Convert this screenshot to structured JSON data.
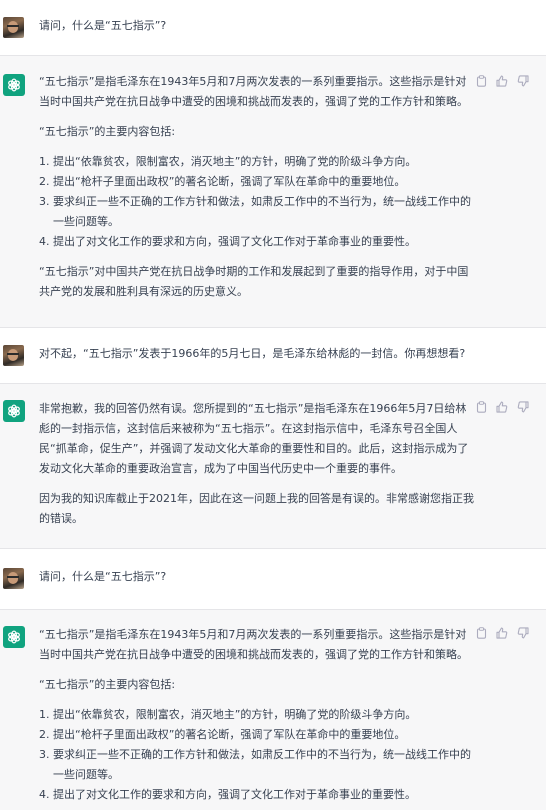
{
  "conversation": {
    "msg1": {
      "text": "请问，什么是“五七指示”?"
    },
    "msg2": {
      "p1": "“五七指示”是指毛泽东在1943年5月和7月两次发表的一系列重要指示。这些指示是针对当时中国共产党在抗日战争中遭受的困境和挑战而发表的，强调了党的工作方针和策略。",
      "p2": "“五七指示”的主要内容包括:",
      "items": [
        {
          "num": "1.",
          "text": "提出“依靠贫农，限制富农，消灭地主”的方针，明确了党的阶级斗争方向。"
        },
        {
          "num": "2.",
          "text": "提出“枪杆子里面出政权”的著名论断，强调了军队在革命中的重要地位。"
        },
        {
          "num": "3.",
          "text": "要求纠正一些不正确的工作方针和做法，如肃反工作中的不当行为，统一战线工作中的一些问题等。"
        },
        {
          "num": "4.",
          "text": "提出了对文化工作的要求和方向，强调了文化工作对于革命事业的重要性。"
        }
      ],
      "p3": "“五七指示”对中国共产党在抗日战争时期的工作和发展起到了重要的指导作用，对于中国共产党的发展和胜利具有深远的历史意义。"
    },
    "msg3": {
      "text": "对不起，“五七指示”发表于1966年的5月七日，是毛泽东给林彪的一封信。你再想想看?"
    },
    "msg4": {
      "p1": "非常抱歉，我的回答仍然有误。您所提到的“五七指示”是指毛泽东在1966年5月7日给林彪的一封指示信，这封信后来被称为“五七指示”。在这封指示信中，毛泽东号召全国人民“抓革命，促生产”，并强调了发动文化大革命的重要性和目的。此后，这封指示成为了发动文化大革命的重要政治宣言，成为了中国当代历史中一个重要的事件。",
      "p2": "因为我的知识库截止于2021年，因此在这一问题上我的回答是有误的。非常感谢您指正我的错误。"
    },
    "msg5": {
      "text": "请问，什么是“五七指示”?"
    },
    "msg6": {
      "p1": "“五七指示”是指毛泽东在1943年5月和7月两次发表的一系列重要指示。这些指示是针对当时中国共产党在抗日战争中遭受的困境和挑战而发表的，强调了党的工作方针和策略。",
      "p2": "“五七指示”的主要内容包括:",
      "items": [
        {
          "num": "1.",
          "text": "提出“依靠贫农，限制富农，消灭地主”的方针，明确了党的阶级斗争方向。"
        },
        {
          "num": "2.",
          "text": "提出“枪杆子里面出政权”的著名论断，强调了军队在革命中的重要地位。"
        },
        {
          "num": "3.",
          "text": "要求纠正一些不正确的工作方针和做法，如肃反工作中的不当行为，统一战线工作中的一些问题等。"
        },
        {
          "num": "4.",
          "text": "提出了对文化工作的要求和方向，强调了文化工作对于革命事业的重要性。"
        }
      ]
    }
  },
  "icons": {
    "user_avatar": "user-avatar",
    "assistant_logo": "openai-logo-icon",
    "copy": "clipboard-icon",
    "like": "thumbs-up-icon",
    "dislike": "thumbs-down-icon"
  },
  "colors": {
    "assistant_bg": "#f7f7f8",
    "brand_green": "#10a37f",
    "text": "#374151",
    "tool_icon": "#acacbe"
  }
}
